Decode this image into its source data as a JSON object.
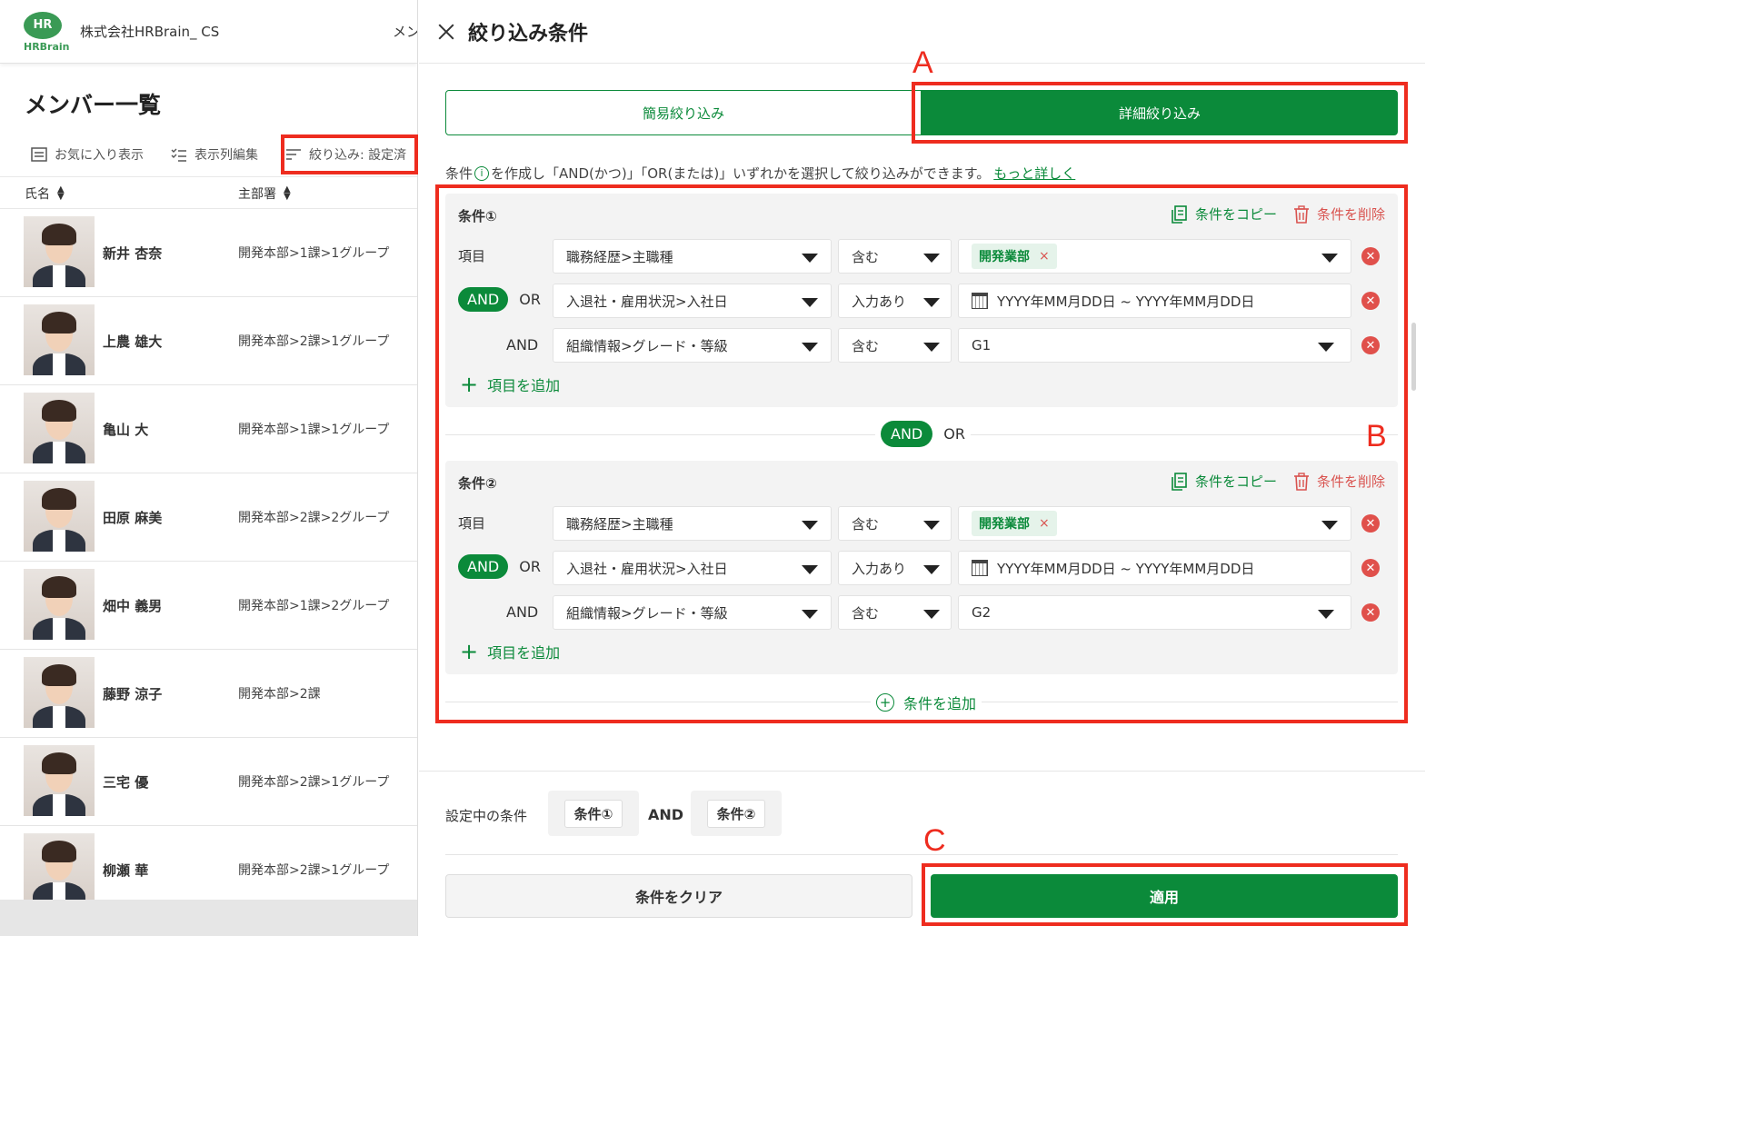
{
  "left": {
    "logo_badge": "HR",
    "logo_wordmark": "HRBrain",
    "company": "株式会社HRBrain_ CS",
    "topbar_cut": "メン",
    "page_title": "メンバー一覧",
    "toolbar": {
      "favorites": "お気に入り表示",
      "columns": "表示列編集",
      "filter": "絞り込み: 設定済"
    },
    "columns": {
      "name": "氏名",
      "dept": "主部署"
    },
    "members": [
      {
        "name": "新井 杏奈",
        "dept": "開発本部>1課>1グループ"
      },
      {
        "name": "上農 雄大",
        "dept": "開発本部>2課>1グループ"
      },
      {
        "name": "亀山 大",
        "dept": "開発本部>1課>1グループ"
      },
      {
        "name": "田原 麻美",
        "dept": "開発本部>2課>2グループ"
      },
      {
        "name": "畑中 義男",
        "dept": "開発本部>1課>2グループ"
      },
      {
        "name": "藤野 涼子",
        "dept": "開発本部>2課"
      },
      {
        "name": "三宅 優",
        "dept": "開発本部>2課>1グループ"
      },
      {
        "name": "柳瀬 華",
        "dept": "開発本部>2課>1グループ"
      }
    ]
  },
  "panel": {
    "title": "絞り込み条件",
    "tabs": {
      "simple": "簡易絞り込み",
      "detail": "詳細絞り込み"
    },
    "hint_pre": "条件",
    "hint_post": "を作成し「AND(かつ)」「OR(または)」いずれかを選択して絞り込みができます。",
    "hint_link": "もっと詳しく",
    "copy_label": "条件をコピー",
    "delete_label": "条件を削除",
    "item_label": "項目",
    "and_label": "AND",
    "or_label": "OR",
    "add_item": "項目を追加",
    "add_condition": "条件を追加",
    "conditions": [
      {
        "title": "条件①",
        "rows": [
          {
            "field": "職務経歴>主職種",
            "op": "含む",
            "chip": "開発業部",
            "remove_x": "×"
          },
          {
            "field": "入退社・雇用状況>入社日",
            "op": "入力あり",
            "value": "YYYY年MM月DD日 ~ YYYY年MM月DD日"
          },
          {
            "field": "組織情報>グレード・等級",
            "op": "含む",
            "value": "G1"
          }
        ]
      },
      {
        "title": "条件②",
        "rows": [
          {
            "field": "職務経歴>主職種",
            "op": "含む",
            "chip": "開発業部",
            "remove_x": "×"
          },
          {
            "field": "入退社・雇用状況>入社日",
            "op": "入力あり",
            "value": "YYYY年MM月DD日 ~ YYYY年MM月DD日"
          },
          {
            "field": "組織情報>グレード・等級",
            "op": "含む",
            "value": "G2"
          }
        ]
      }
    ],
    "footer": {
      "current_label": "設定中の条件",
      "tag1": "条件①",
      "joiner": "AND",
      "tag2": "条件②",
      "clear": "条件をクリア",
      "apply": "適用"
    }
  },
  "annotations": {
    "a": "A",
    "b": "B",
    "c": "C"
  },
  "colors": {
    "accent": "#0b8a3a",
    "danger": "#e0504b",
    "highlight": "#ee2c1f"
  }
}
